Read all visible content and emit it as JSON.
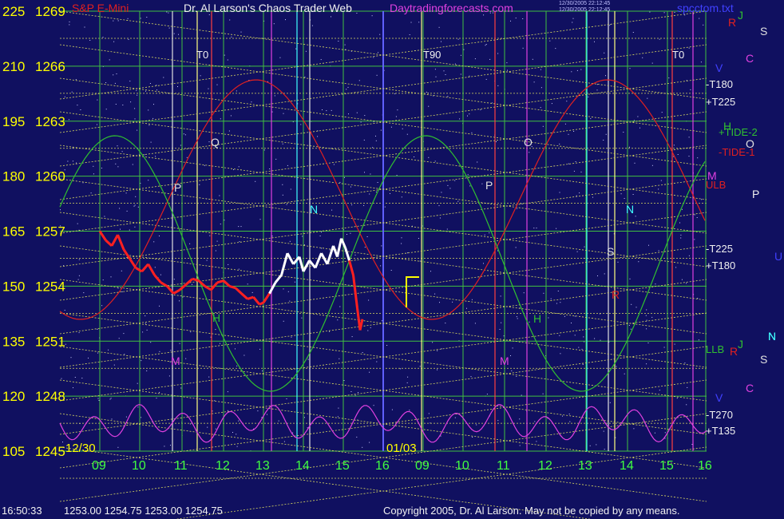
{
  "header": {
    "title": "Dr. Al Larson's Chaos Trader Web",
    "symbol": "S&P E-Mini",
    "site": "Daytradingforecasts.com",
    "file": "spcctom.txt",
    "file_stamp_1": "12/30/2005 22:12:45",
    "file_stamp_2": "12/30/2005 22:12:45"
  },
  "footer": {
    "time": "16:50:33",
    "ohlc": "1253.00 1254.75 1253.00 1254.75",
    "copyright": "Copyright 2005, Dr. Al Larson. May not be copied by any means."
  },
  "colors": {
    "background": "#101060",
    "grid_green": "#40c040",
    "grid_yellow": "#d8d860",
    "price_red": "#ff2020",
    "price_white": "#ffffff",
    "tide_red": "#e02020",
    "tide_green": "#30c030",
    "osc_magenta": "#e040e0"
  },
  "chart_data": {
    "type": "line",
    "y_left": {
      "ticks": [
        "225",
        "210",
        "195",
        "180",
        "165",
        "150",
        "135",
        "120",
        "105"
      ],
      "ylim": [
        105,
        225
      ]
    },
    "y_price": {
      "ticks": [
        "1269",
        "1266",
        "1263",
        "1260",
        "1257",
        "1254",
        "1251",
        "1248",
        "1245"
      ],
      "ylim": [
        1245,
        1269
      ]
    },
    "x_ticks": [
      "09",
      "10",
      "11",
      "12",
      "13",
      "14",
      "15",
      "16",
      "09",
      "10",
      "11",
      "12",
      "13",
      "14",
      "15",
      "16"
    ],
    "date_labels": [
      "12/30",
      "01/03"
    ],
    "cycle_labels_top": [
      "T0",
      "T90",
      "T0"
    ],
    "right_labels": [
      "-T180",
      "+T225",
      "+TIDE-2",
      "-TIDE-1",
      "ULB",
      "-T225",
      "+T180",
      "LLB",
      "-T270",
      "+T135"
    ],
    "planet_letters_top": [
      "R",
      "S",
      "C",
      "V",
      "H",
      "O",
      "M",
      "P",
      "U",
      "J",
      "N"
    ],
    "planet_letters_bottom": [
      "J",
      "N",
      "S",
      "C",
      "V",
      "R"
    ],
    "in_chart_letters": [
      "Q",
      "P",
      "N",
      "H",
      "M",
      "S",
      "R",
      "O",
      "P",
      "N",
      "H",
      "M"
    ],
    "price_series": [
      {
        "t": 0.0,
        "p": 1257.0
      },
      {
        "t": 0.15,
        "p": 1256.5
      },
      {
        "t": 0.3,
        "p": 1256.2
      },
      {
        "t": 0.45,
        "p": 1256.8
      },
      {
        "t": 0.6,
        "p": 1256.0
      },
      {
        "t": 0.75,
        "p": 1255.5
      },
      {
        "t": 0.9,
        "p": 1255.0
      },
      {
        "t": 1.05,
        "p": 1254.8
      },
      {
        "t": 1.2,
        "p": 1255.2
      },
      {
        "t": 1.35,
        "p": 1254.6
      },
      {
        "t": 1.5,
        "p": 1254.2
      },
      {
        "t": 1.65,
        "p": 1254.0
      },
      {
        "t": 1.8,
        "p": 1253.6
      },
      {
        "t": 1.95,
        "p": 1253.8
      },
      {
        "t": 2.1,
        "p": 1254.1
      },
      {
        "t": 2.25,
        "p": 1254.4
      },
      {
        "t": 2.4,
        "p": 1254.3
      },
      {
        "t": 2.55,
        "p": 1254.0
      },
      {
        "t": 2.7,
        "p": 1253.8
      },
      {
        "t": 2.85,
        "p": 1254.2
      },
      {
        "t": 3.0,
        "p": 1254.3
      },
      {
        "t": 3.15,
        "p": 1254.0
      },
      {
        "t": 3.3,
        "p": 1253.9
      },
      {
        "t": 3.45,
        "p": 1253.6
      },
      {
        "t": 3.6,
        "p": 1253.3
      },
      {
        "t": 3.75,
        "p": 1253.4
      },
      {
        "t": 3.9,
        "p": 1253.0
      },
      {
        "t": 4.0,
        "p": 1253.1
      },
      {
        "t": 4.15,
        "p": 1253.6
      },
      {
        "t": 4.3,
        "p": 1254.2
      },
      {
        "t": 4.45,
        "p": 1254.6
      },
      {
        "t": 4.6,
        "p": 1255.8
      },
      {
        "t": 4.75,
        "p": 1255.2
      },
      {
        "t": 4.9,
        "p": 1255.6
      },
      {
        "t": 5.0,
        "p": 1254.8
      },
      {
        "t": 5.15,
        "p": 1255.4
      },
      {
        "t": 5.3,
        "p": 1255.0
      },
      {
        "t": 5.45,
        "p": 1255.8
      },
      {
        "t": 5.6,
        "p": 1255.2
      },
      {
        "t": 5.75,
        "p": 1256.2
      },
      {
        "t": 5.85,
        "p": 1255.6
      },
      {
        "t": 5.95,
        "p": 1256.6
      },
      {
        "t": 6.05,
        "p": 1256.1
      },
      {
        "t": 6.15,
        "p": 1255.4
      },
      {
        "t": 6.25,
        "p": 1254.6
      },
      {
        "t": 6.35,
        "p": 1252.8
      },
      {
        "t": 6.42,
        "p": 1251.6
      },
      {
        "t": 6.48,
        "p": 1252.2
      }
    ],
    "grid": true
  }
}
